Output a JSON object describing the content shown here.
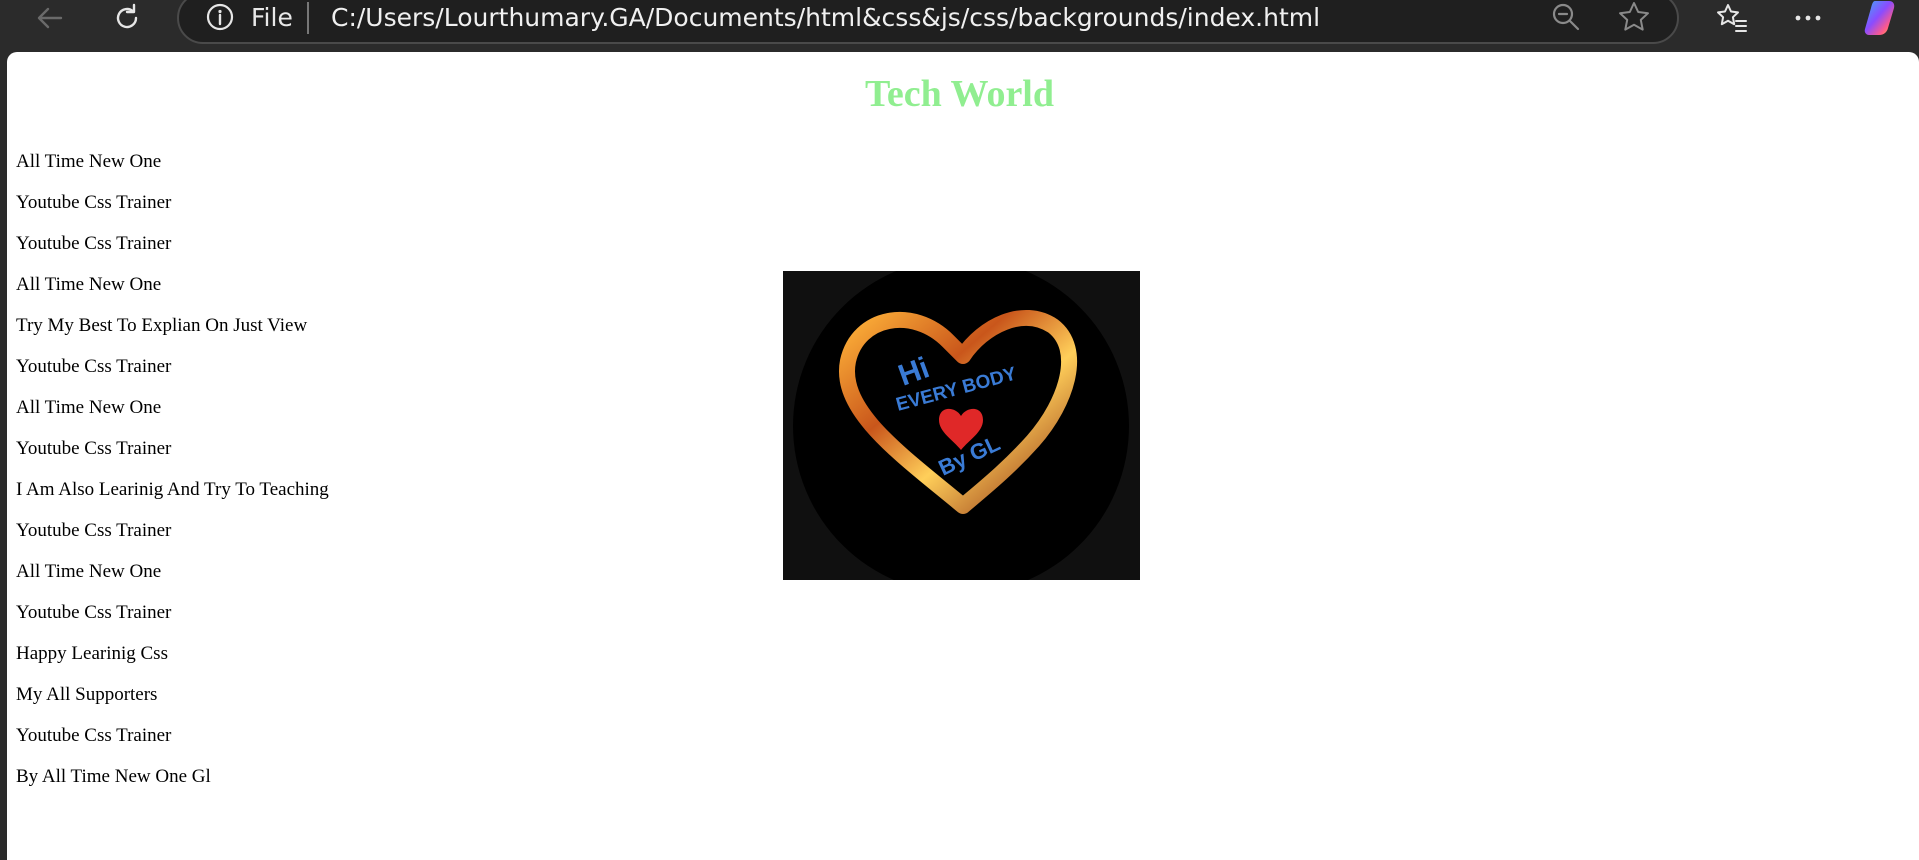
{
  "browser": {
    "file_label": "File",
    "url": "C:/Users/Lourthumary.GA/Documents/html&css&js/css/backgrounds/index.html",
    "icons": [
      "back-arrow-icon",
      "refresh-icon",
      "info-icon",
      "zoom-out-icon",
      "favorite-star-icon",
      "favorites-list-icon",
      "more-options-icon",
      "copilot-icon"
    ]
  },
  "page": {
    "title": "Tech World",
    "title_color": "#90ee90",
    "lines": [
      "All Time New One",
      "Youtube Css Trainer",
      "Youtube Css Trainer",
      "All Time New One",
      "Try My Best To Explian On Just View",
      "Youtube Css Trainer",
      "All Time New One",
      "Youtube Css Trainer",
      "I Am Also Learinig And Try To Teaching",
      "Youtube Css Trainer",
      "All Time New One",
      "Youtube Css Trainer",
      "Happy Learinig Css",
      "My All Supporters",
      "Youtube Css Trainer",
      "By All Time New One Gl"
    ],
    "logo": {
      "text_hi": "Hi",
      "text_every": "EVERY BODY",
      "text_by": "By GL"
    }
  }
}
